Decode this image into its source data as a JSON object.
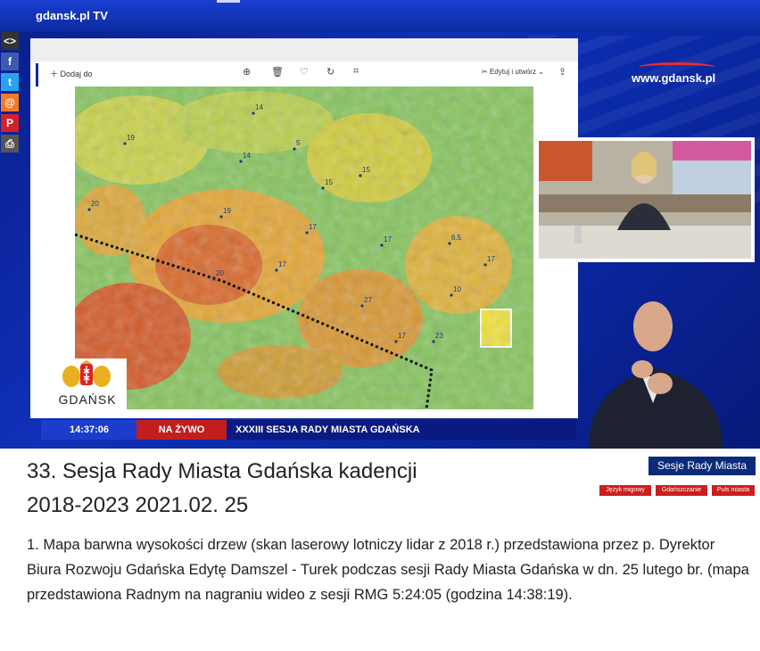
{
  "stage": {
    "brand": "gdansk.pl TV",
    "url_watermark": "www.gdansk.pl",
    "share_icons": [
      "embed-icon",
      "facebook-icon",
      "twitter-icon",
      "email-icon",
      "pinterest-icon",
      "print-icon"
    ]
  },
  "viewer_toolbar": {
    "add_label": "Dodaj do",
    "edit_label": "Edytuj i utwórz"
  },
  "map": {
    "labels": [
      "14",
      "5",
      "19",
      "14",
      "15",
      "15",
      "20",
      "19",
      "17",
      "17",
      "6.5",
      "17",
      "17",
      "20",
      "27",
      "10",
      "17",
      "23"
    ]
  },
  "logo": {
    "name": "GDAŃSK"
  },
  "ticker": {
    "time": "14:37:06",
    "live": "NA ŻYWO",
    "title": "XXXIII SESJA RADY MIASTA GDAŃSKA"
  },
  "article": {
    "title_line1": "33. Sesja Rady Miasta Gdańska kadencji",
    "title_line2": "2018-2023 2021.02. 25",
    "category": "Sesje Rady Miasta",
    "tags": [
      "Język migowy",
      "Gdańszczanie",
      "Puls miasta"
    ],
    "description": "1. Mapa barwna wysokości drzew (skan laserowy lotniczy lidar z 2018 r.) przedstawiona przez p. Dyrektor Biura Rozwoju Gdańska Edytę Damszel - Turek podczas sesji Rady Miasta Gdańska w dn. 25 lutego br. (mapa przedstawiona Radnym na nagraniu wideo z sesji RMG 5:24:05 (godzina 14:38:19)."
  },
  "colors": {
    "stage_blue": "#1030b8",
    "ticker_blue": "#1c3ccc",
    "live_red": "#c21e1e",
    "tag_red": "#cc1e1e",
    "category_navy": "#0b2a7a"
  }
}
